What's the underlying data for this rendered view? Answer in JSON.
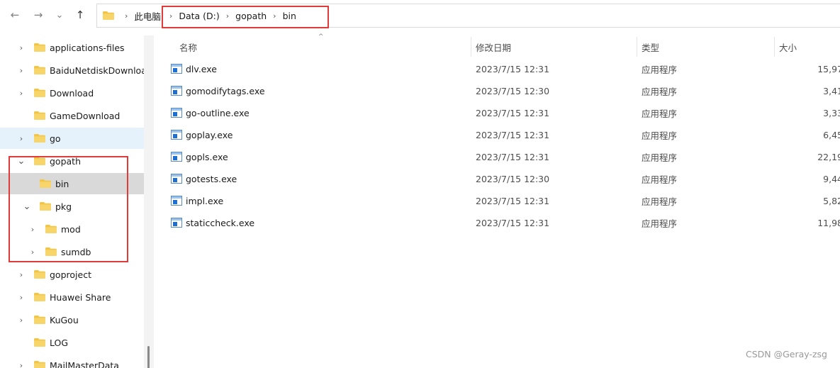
{
  "nav": {
    "back_glyph": "←",
    "forward_glyph": "→",
    "recent_glyph": "⌄",
    "up_glyph": "↑",
    "chevron_glyph": "›"
  },
  "breadcrumb": {
    "items": [
      "此电脑",
      "Data (D:)",
      "gopath",
      "bin"
    ]
  },
  "sidebar": {
    "items": [
      {
        "label": "applications-files",
        "chevron": "›"
      },
      {
        "label": "BaiduNetdiskDownload",
        "chevron": "›"
      },
      {
        "label": "Download",
        "chevron": "›"
      },
      {
        "label": "GameDownload",
        "chevron": ""
      },
      {
        "label": "go",
        "chevron": "›"
      },
      {
        "label": "gopath",
        "chevron": "⌄"
      },
      {
        "label": "bin",
        "chevron": ""
      },
      {
        "label": "pkg",
        "chevron": "⌄"
      },
      {
        "label": "mod",
        "chevron": "›"
      },
      {
        "label": "sumdb",
        "chevron": "›"
      },
      {
        "label": "goproject",
        "chevron": "›"
      },
      {
        "label": "Huawei Share",
        "chevron": "›"
      },
      {
        "label": "KuGou",
        "chevron": "›"
      },
      {
        "label": "LOG",
        "chevron": ""
      },
      {
        "label": "MailMasterData",
        "chevron": "›"
      }
    ]
  },
  "columns": {
    "name": "名称",
    "date": "修改日期",
    "type": "类型",
    "size": "大小",
    "sort_glyph": "^"
  },
  "files": [
    {
      "name": "dlv.exe",
      "date": "2023/7/15 12:31",
      "type": "应用程序",
      "size": "15,97"
    },
    {
      "name": "gomodifytags.exe",
      "date": "2023/7/15 12:30",
      "type": "应用程序",
      "size": "3,41"
    },
    {
      "name": "go-outline.exe",
      "date": "2023/7/15 12:31",
      "type": "应用程序",
      "size": "3,33"
    },
    {
      "name": "goplay.exe",
      "date": "2023/7/15 12:31",
      "type": "应用程序",
      "size": "6,45"
    },
    {
      "name": "gopls.exe",
      "date": "2023/7/15 12:31",
      "type": "应用程序",
      "size": "22,19"
    },
    {
      "name": "gotests.exe",
      "date": "2023/7/15 12:30",
      "type": "应用程序",
      "size": "9,44"
    },
    {
      "name": "impl.exe",
      "date": "2023/7/15 12:31",
      "type": "应用程序",
      "size": "5,82"
    },
    {
      "name": "staticcheck.exe",
      "date": "2023/7/15 12:31",
      "type": "应用程序",
      "size": "11,98"
    }
  ],
  "watermark": "CSDN @Geray-zsg",
  "colors": {
    "folder": "#f4c542",
    "highlight": "#e03a3a",
    "selected": "#d9d9d9",
    "hover": "#e5f1fb"
  },
  "icons": {
    "file": "exe-app-icon",
    "folder": "folder-icon"
  }
}
